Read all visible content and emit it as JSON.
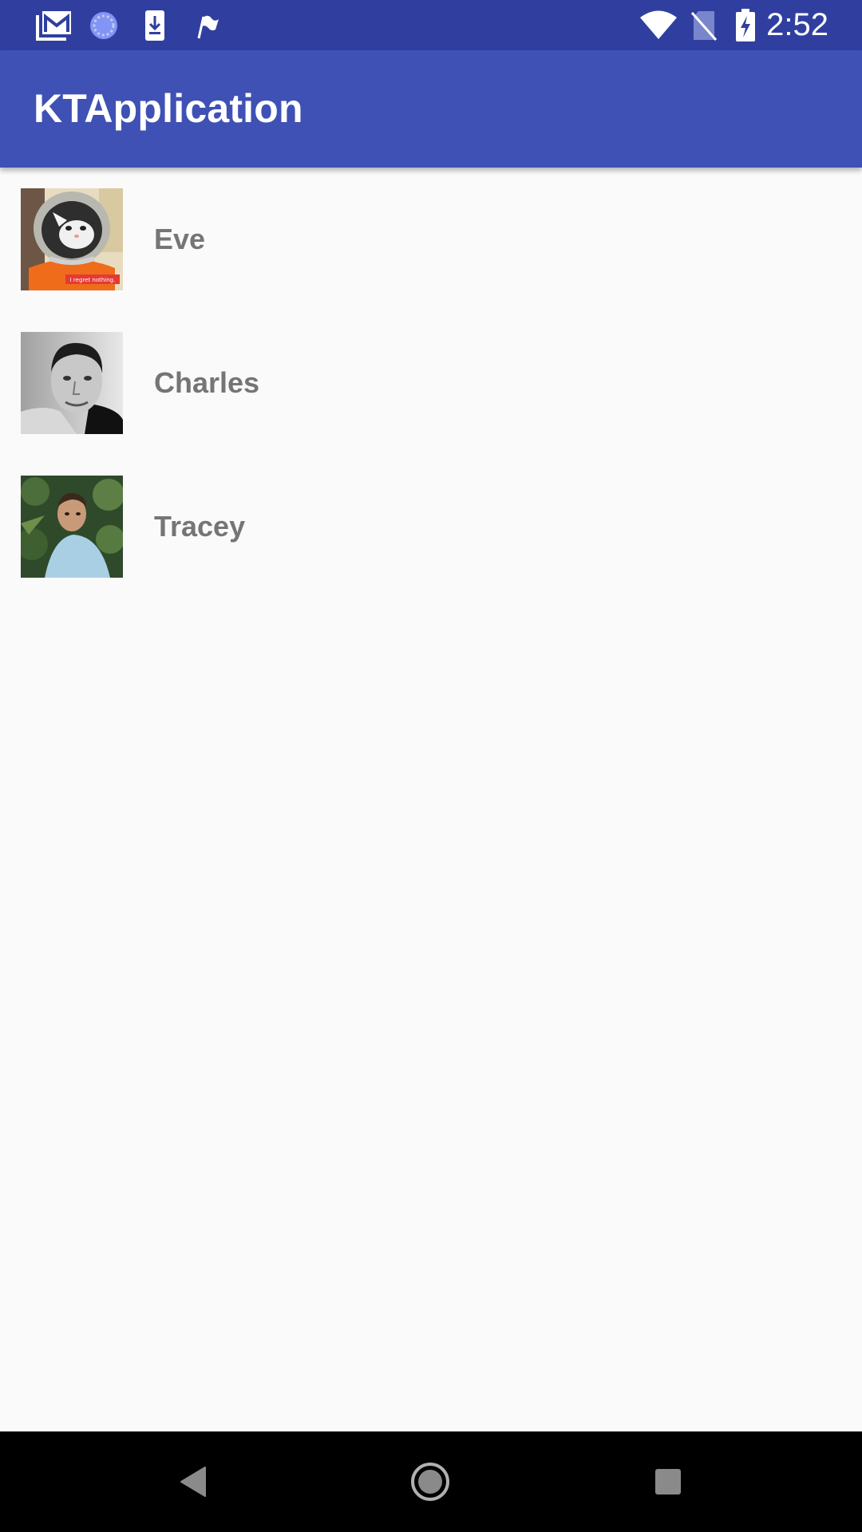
{
  "status_bar": {
    "time": "2:52",
    "left_icons": [
      "gmail-icon",
      "sync-icon",
      "download-icon",
      "flag-icon"
    ],
    "right_icons": [
      "wifi-icon",
      "no-sim-icon",
      "battery-charging-icon"
    ]
  },
  "app_bar": {
    "title": "KTApplication",
    "color": "#3f51b5",
    "status_color": "#303f9f"
  },
  "contacts": [
    {
      "name": "Eve",
      "avatar": "astronaut-cat-avatar",
      "avatar_caption": "I regret nothing."
    },
    {
      "name": "Charles",
      "avatar": "grayscale-man-portrait-avatar"
    },
    {
      "name": "Tracey",
      "avatar": "outdoor-man-portrait-avatar"
    }
  ],
  "nav_bar": {
    "buttons": [
      "back-icon",
      "home-icon",
      "recents-icon"
    ]
  }
}
